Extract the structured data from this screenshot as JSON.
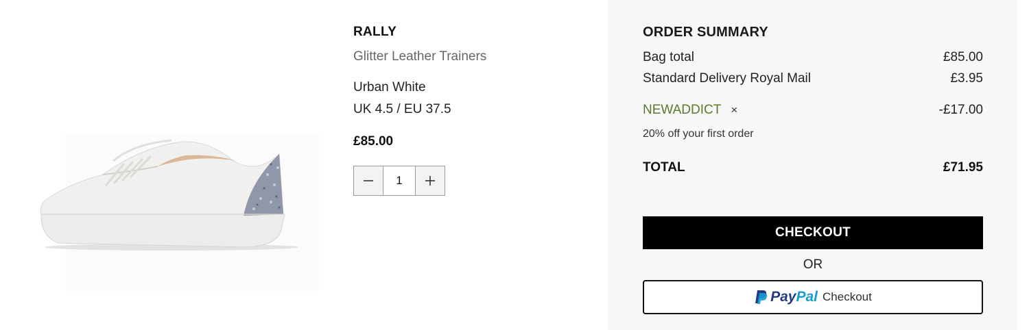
{
  "product": {
    "image_icon": "white-leather-trainer-with-glitter-heel",
    "brand": "RALLY",
    "name": "Glitter Leather Trainers",
    "colour": "Urban White",
    "size": "UK 4.5 / EU 37.5",
    "price": "£85.00",
    "quantity": "1",
    "decrement_icon": "minus-icon",
    "increment_icon": "plus-icon"
  },
  "summary": {
    "title": "ORDER SUMMARY",
    "bag_total_label": "Bag total",
    "bag_total_value": "£85.00",
    "delivery_label": "Standard Delivery Royal Mail",
    "delivery_value": "£3.95",
    "promo_code": "NEWADDICT",
    "promo_remove": "×",
    "promo_value": "-£17.00",
    "promo_description": "20% off your first order",
    "total_label": "TOTAL",
    "total_value": "£71.95",
    "checkout_label": "CHECKOUT",
    "or_label": "OR",
    "paypal_pay": "Pay",
    "paypal_pal": "Pal",
    "paypal_checkout": "Checkout"
  },
  "colors": {
    "promo_green": "#5a7a2e",
    "paypal_dark_blue": "#253b80",
    "paypal_light_blue": "#179bd7",
    "summary_bg": "#f7f7f7"
  }
}
